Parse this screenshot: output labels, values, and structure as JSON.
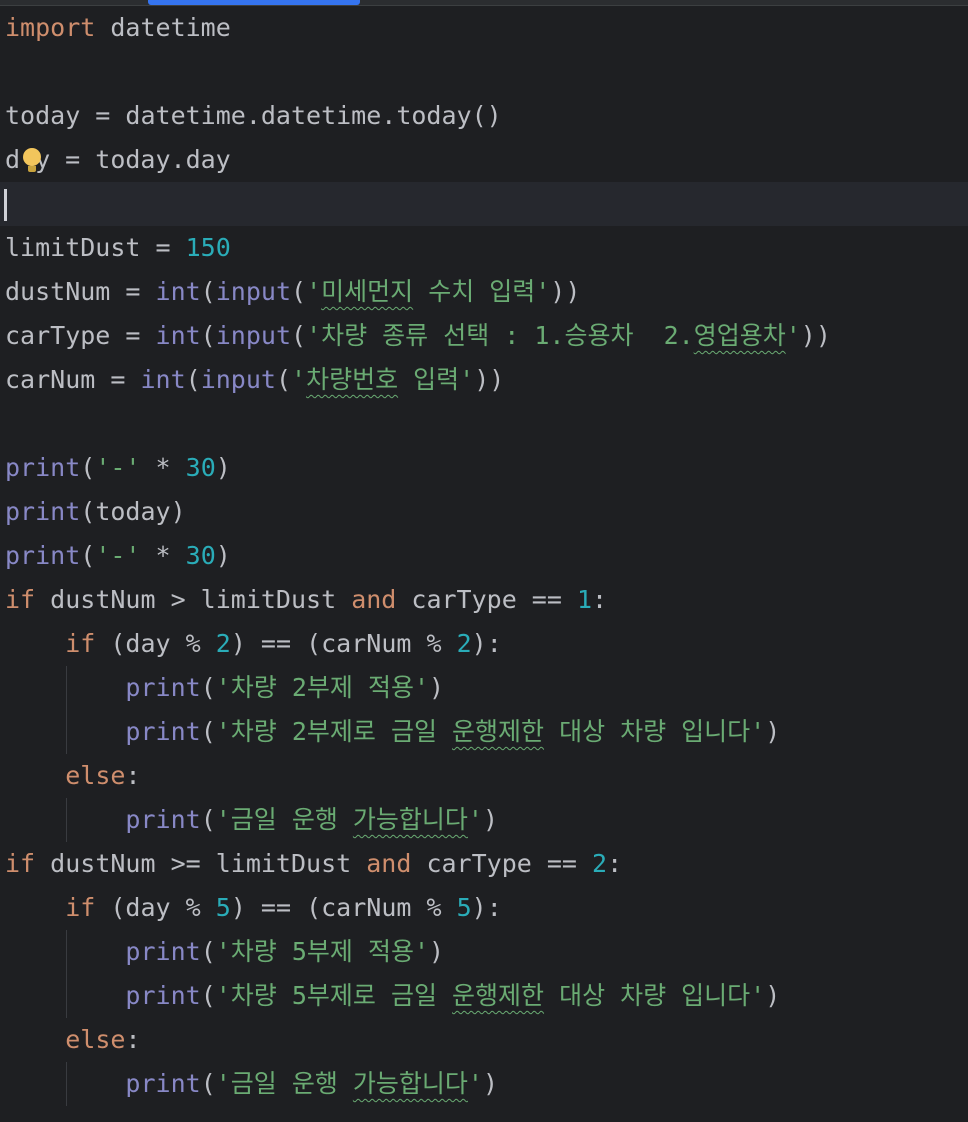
{
  "lines": {
    "l1": {
      "kw": "import",
      "rest": " datetime"
    },
    "l3": "today = datetime.datetime.today()",
    "l4": {
      "a": "d",
      "b": "y = today.day"
    },
    "l6": {
      "a": "limitDust = ",
      "num": "150"
    },
    "l7": {
      "a": "dustNum = ",
      "fn1": "int",
      "p1": "(",
      "fn2": "input",
      "p2": "(",
      "s1": "'",
      "typo": "미세먼지",
      "s2": " 수치 입력'",
      "p3": "))"
    },
    "l8": {
      "a": "carType = ",
      "fn1": "int",
      "p1": "(",
      "fn2": "input",
      "p2": "(",
      "s1": "'차량 종류 선택 : 1.승용차  2.",
      "typo": "영업용차",
      "s2": "'",
      "p3": "))"
    },
    "l9": {
      "a": "carNum = ",
      "fn1": "int",
      "p1": "(",
      "fn2": "input",
      "p2": "(",
      "s1": "'",
      "typo": "차량번호",
      "s2": " 입력'",
      "p3": "))"
    },
    "l11": {
      "fn": "print",
      "p1": "(",
      "s": "'-'",
      "op": " * ",
      "num": "30",
      "p2": ")"
    },
    "l12": {
      "fn": "print",
      "rest": "(today)"
    },
    "l13": {
      "fn": "print",
      "p1": "(",
      "s": "'-'",
      "op": " * ",
      "num": "30",
      "p2": ")"
    },
    "l14": {
      "kw1": "if",
      "a": " dustNum > limitDust ",
      "kw2": "and",
      "b": " carType == ",
      "num": "1",
      "c": ":"
    },
    "l15": {
      "kw": "if",
      "a": " (day % ",
      "n1": "2",
      "b": ") == (carNum % ",
      "n2": "2",
      "c": "):"
    },
    "l16": {
      "fn": "print",
      "p1": "(",
      "s": "'차량 2부제 적용'",
      "p2": ")"
    },
    "l17": {
      "fn": "print",
      "p1": "(",
      "s1": "'차량 2부제로 금일 ",
      "typo": "운행제한",
      "s2": " 대상 차량 입니다'",
      "p2": ")"
    },
    "l18": {
      "kw": "else",
      "c": ":"
    },
    "l19": {
      "fn": "print",
      "p1": "(",
      "s1": "'금일 운행 ",
      "typo": "가능합니다",
      "s2": "'",
      "p2": ")"
    },
    "l20": {
      "kw1": "if",
      "a": " dustNum >= limitDust ",
      "kw2": "and",
      "b": " carType == ",
      "num": "2",
      "c": ":"
    },
    "l21": {
      "kw": "if",
      "a": " (day % ",
      "n1": "5",
      "b": ") == (carNum % ",
      "n2": "5",
      "c": "):"
    },
    "l22": {
      "fn": "print",
      "p1": "(",
      "s": "'차량 5부제 적용'",
      "p2": ")"
    },
    "l23": {
      "fn": "print",
      "p1": "(",
      "s1": "'차량 5부제로 금일 ",
      "typo": "운행제한",
      "s2": " 대상 차량 입니다'",
      "p2": ")"
    },
    "l24": {
      "kw": "else",
      "c": ":"
    },
    "l25": {
      "fn": "print",
      "p1": "(",
      "s1": "'금일 운행 ",
      "typo": "가능합니다",
      "s2": "'",
      "p2": ")"
    }
  },
  "icons": {
    "intention": "lightbulb-icon"
  }
}
